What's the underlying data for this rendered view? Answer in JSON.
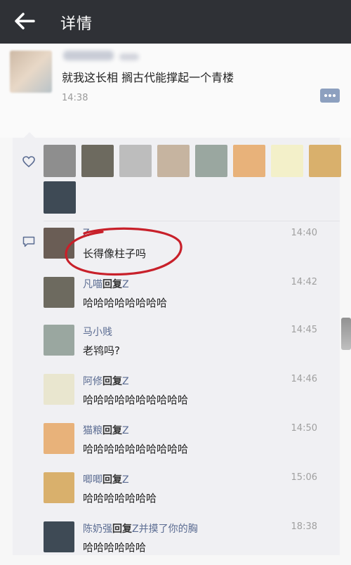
{
  "header": {
    "title": "详情"
  },
  "post": {
    "text": "就我这长相 搁古代能撑起一个青楼",
    "time": "14:38"
  },
  "likes": {
    "avatars": [
      {
        "name": "like-avatar-1",
        "color": "#8e8e8e"
      },
      {
        "name": "like-avatar-2",
        "color": "#6d6a5f"
      },
      {
        "name": "like-avatar-3",
        "color": "#bdbdbd"
      },
      {
        "name": "like-avatar-4",
        "color": "#c6b4a0"
      },
      {
        "name": "like-avatar-5",
        "color": "#9aa7a0"
      },
      {
        "name": "like-avatar-6",
        "color": "#e8b27a"
      },
      {
        "name": "like-avatar-7",
        "color": "#f3f0c9"
      },
      {
        "name": "like-avatar-8",
        "color": "#d9b06c"
      },
      {
        "name": "like-avatar-9",
        "color": "#3e4a55"
      }
    ]
  },
  "comments": [
    {
      "name": "Z",
      "reply": "",
      "reply_to": "",
      "time": "14:40",
      "text": "长得像柱子吗",
      "avatar_color": "#6a5d55"
    },
    {
      "name": "凡喵",
      "reply": "回复",
      "reply_to": "Z",
      "time": "14:42",
      "text": "哈哈哈哈哈哈哈哈",
      "avatar_color": "#6d6a5f"
    },
    {
      "name": "马小贱",
      "reply": "",
      "reply_to": "",
      "time": "14:45",
      "text": "老鸨吗?",
      "avatar_color": "#9aa7a0"
    },
    {
      "name": "阿修",
      "reply": "回复",
      "reply_to": "Z",
      "time": "14:46",
      "text": "哈哈哈哈哈哈哈哈哈哈",
      "avatar_color": "#e9e6cf"
    },
    {
      "name": "猫粮",
      "reply": "回复",
      "reply_to": "Z",
      "time": "14:50",
      "text": "哈哈哈哈哈哈哈哈哈哈",
      "avatar_color": "#e8b27a"
    },
    {
      "name": "唧唧",
      "reply": "回复",
      "reply_to": "Z",
      "time": "15:06",
      "text": "哈哈哈哈哈哈哈",
      "avatar_color": "#d9b06c"
    },
    {
      "name": "陈奶强",
      "reply": "回复",
      "reply_to": "Z并摸了你的胸",
      "time": "18:38",
      "text": "哈哈哈哈哈哈",
      "avatar_color": "#3e4a55"
    }
  ],
  "colors": {
    "topbar": "#2f3136",
    "link": "#5b6c92",
    "annotation_circle": "#c8202a"
  }
}
